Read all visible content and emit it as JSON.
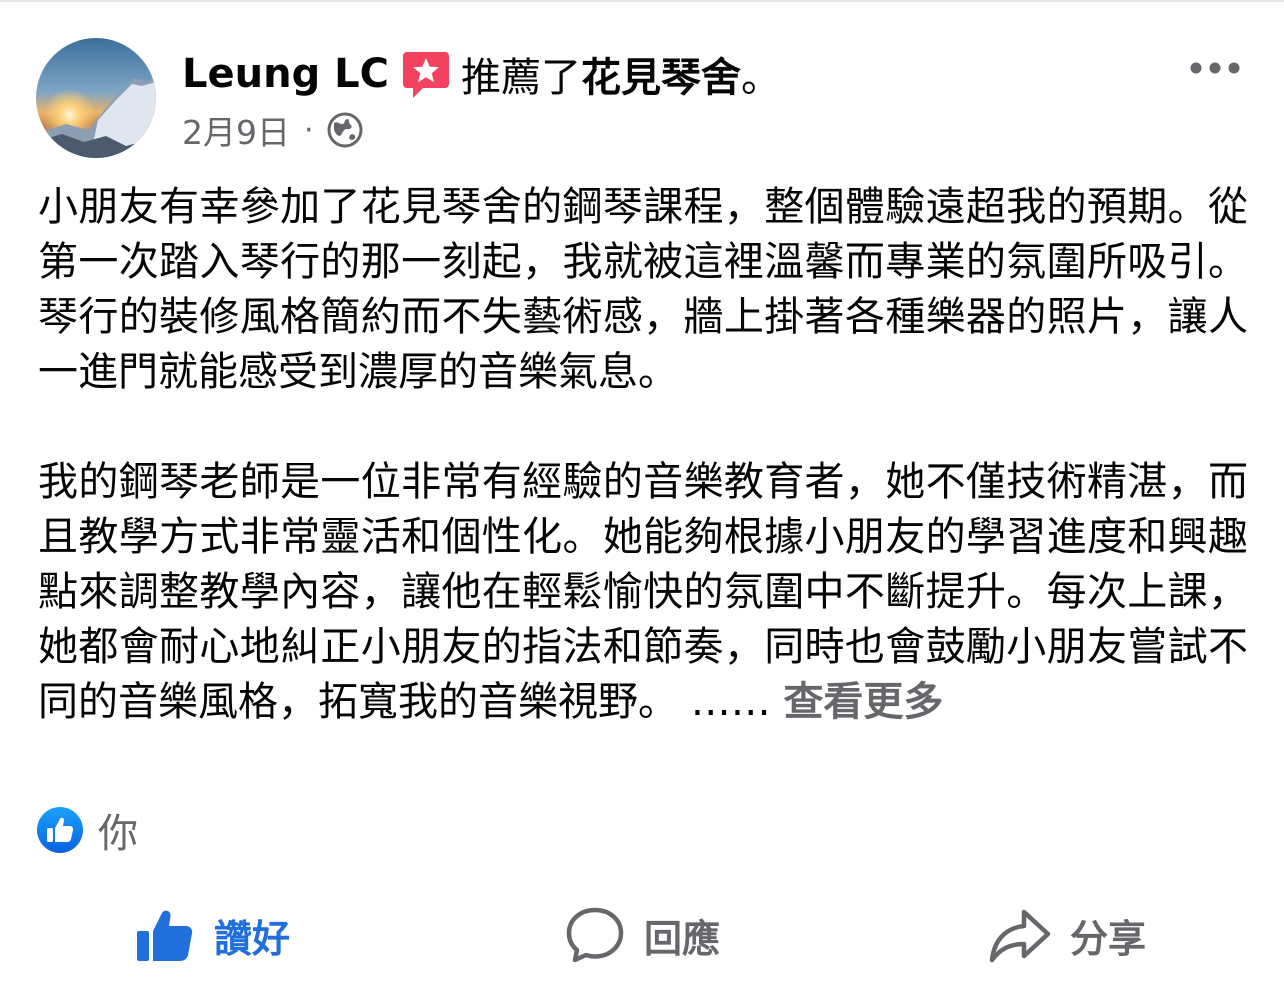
{
  "post": {
    "author": "Leung LC",
    "action_text": "推薦了",
    "page_name": "花見琴舍",
    "action_suffix": "。",
    "date": "2月9日",
    "meta_separator": "·",
    "audience_icon": "globe-icon",
    "recommend_icon": "recommend-star-icon",
    "more_icon": "more-options-icon",
    "paragraphs": [
      "小朋友有幸參加了花見琴舍的鋼琴課程，整個體驗遠超我的預期。從第一次踏入琴行的那一刻起，我就被這裡溫馨而專業的氛圍所吸引。琴行的裝修風格簡約而不失藝術感，牆上掛著各種樂器的照片，讓人一進門就能感受到濃厚的音樂氣息。",
      "我的鋼琴老師是一位非常有經驗的音樂教育者，她不僅技術精湛，而且教學方式非常靈活和個性化。她能夠根據小朋友的學習進度和興趣點來調整教學內容，讓他在輕鬆愉快的氛圍中不斷提升。每次上課，她都會耐心地糾正小朋友的指法和節奏，同時也會鼓勵小朋友嘗試不同的音樂風格，拓寬我的音樂視野。"
    ],
    "ellipsis": "……",
    "see_more": "查看更多"
  },
  "reactions": {
    "icon": "like-badge-icon",
    "names": "你"
  },
  "actions": {
    "like": {
      "label": "讚好",
      "icon": "thumbs-up-icon",
      "active": true
    },
    "comment": {
      "label": "回應",
      "icon": "comment-bubble-icon"
    },
    "share": {
      "label": "分享",
      "icon": "share-arrow-icon"
    }
  },
  "colors": {
    "primary_text": "#050505",
    "secondary_text": "#65676b",
    "like_blue": "#216fdb",
    "recommend_red": "#f3425f"
  }
}
